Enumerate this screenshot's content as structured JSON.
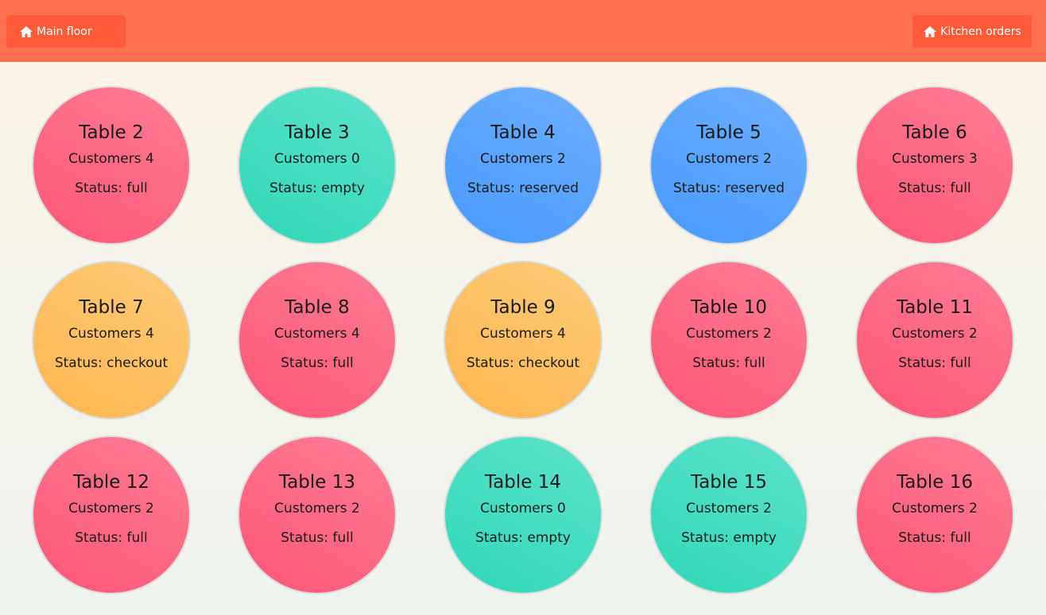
{
  "nav": {
    "main_floor_label": "Main floor",
    "kitchen_orders_label": "Kitchen orders"
  },
  "tables": [
    {
      "name": "Table 2",
      "customers": "Customers 4",
      "status": "Status: full",
      "state": "full"
    },
    {
      "name": "Table 3",
      "customers": "Customers 0",
      "status": "Status: empty",
      "state": "empty"
    },
    {
      "name": "Table 4",
      "customers": "Customers 2",
      "status": "Status: reserved",
      "state": "reserved"
    },
    {
      "name": "Table 5",
      "customers": "Customers 2",
      "status": "Status: reserved",
      "state": "reserved"
    },
    {
      "name": "Table 6",
      "customers": "Customers 3",
      "status": "Status: full",
      "state": "full"
    },
    {
      "name": "Table 7",
      "customers": "Customers 4",
      "status": "Status: checkout",
      "state": "checkout"
    },
    {
      "name": "Table 8",
      "customers": "Customers 4",
      "status": "Status: full",
      "state": "full"
    },
    {
      "name": "Table 9",
      "customers": "Customers 4",
      "status": "Status: checkout",
      "state": "checkout"
    },
    {
      "name": "Table 10",
      "customers": "Customers 2",
      "status": "Status: full",
      "state": "full"
    },
    {
      "name": "Table 11",
      "customers": "Customers 2",
      "status": "Status: full",
      "state": "full"
    },
    {
      "name": "Table 12",
      "customers": "Customers 2",
      "status": "Status: full",
      "state": "full"
    },
    {
      "name": "Table 13",
      "customers": "Customers 2",
      "status": "Status: full",
      "state": "full"
    },
    {
      "name": "Table 14",
      "customers": "Customers 0",
      "status": "Status: empty",
      "state": "empty"
    },
    {
      "name": "Table 15",
      "customers": "Customers 2",
      "status": "Status: empty",
      "state": "empty"
    },
    {
      "name": "Table 16",
      "customers": "Customers 2",
      "status": "Status: full",
      "state": "full"
    }
  ],
  "colors": {
    "topbar": "#fe7150",
    "nav_button": "#ff5a3a",
    "full": "#fe5676",
    "empty": "#2fd9b7",
    "reserved": "#4899fe",
    "checkout": "#ffb64f"
  }
}
